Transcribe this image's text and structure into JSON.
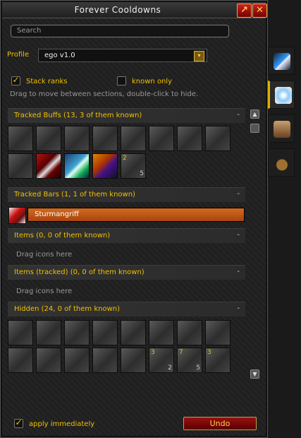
{
  "window": {
    "title": "Forever Cooldowns",
    "buttons": {
      "popout_icon": "popout-arrow-icon",
      "close_label": "✕"
    }
  },
  "search": {
    "placeholder": "Search"
  },
  "profile": {
    "label": "Profile",
    "value": "ego v1.0"
  },
  "options": {
    "stack_ranks": {
      "label": "Stack ranks",
      "checked": true
    },
    "known_only": {
      "label": "known only",
      "checked": false
    },
    "hint": "Drag to move between sections, double-click to hide."
  },
  "sections": {
    "tracked_buffs": {
      "title": "Tracked Buffs  (13, 3 of them known)",
      "collapse": "-",
      "icons": [
        {
          "style": ""
        },
        {
          "style": ""
        },
        {
          "style": ""
        },
        {
          "style": ""
        },
        {
          "style": ""
        },
        {
          "style": ""
        },
        {
          "style": ""
        },
        {
          "style": ""
        },
        {
          "style": ""
        },
        {
          "style": "col1"
        },
        {
          "style": "col2"
        },
        {
          "style": "col3"
        },
        {
          "style": "",
          "count_tl": "2",
          "count_br": "5"
        }
      ]
    },
    "tracked_bars": {
      "title": "Tracked Bars  (1, 1 of them known)",
      "collapse": "-",
      "bar_label": "Sturmangriff"
    },
    "items": {
      "title": "Items  (0, 0 of them known)",
      "collapse": "-",
      "placeholder": "Drag icons here"
    },
    "items_tracked": {
      "title": "Items (tracked)  (0, 0 of them known)",
      "collapse": "-",
      "placeholder": "Drag icons here"
    },
    "hidden": {
      "title": "Hidden  (24, 0 of them known)",
      "collapse": "-",
      "icons": [
        {
          "style": ""
        },
        {
          "style": ""
        },
        {
          "style": ""
        },
        {
          "style": ""
        },
        {
          "style": ""
        },
        {
          "style": ""
        },
        {
          "style": ""
        },
        {
          "style": ""
        },
        {
          "style": ""
        },
        {
          "style": ""
        },
        {
          "style": ""
        },
        {
          "style": ""
        },
        {
          "style": ""
        },
        {
          "style": "",
          "count_tl": "3",
          "count_br": "2"
        },
        {
          "style": "",
          "count_tl": "7",
          "count_br": "5"
        },
        {
          "style": "",
          "count_tl": "3"
        }
      ]
    }
  },
  "footer": {
    "apply_immediately": {
      "label": "apply immediately",
      "checked": true
    },
    "undo_label": "Undo"
  },
  "side_tabs": [
    {
      "icon": "lightning-icon",
      "active": false
    },
    {
      "icon": "frost-crystal-icon",
      "active": true
    },
    {
      "icon": "scroll-book-icon",
      "active": false
    },
    {
      "icon": "pouch-icon",
      "active": false
    }
  ]
}
